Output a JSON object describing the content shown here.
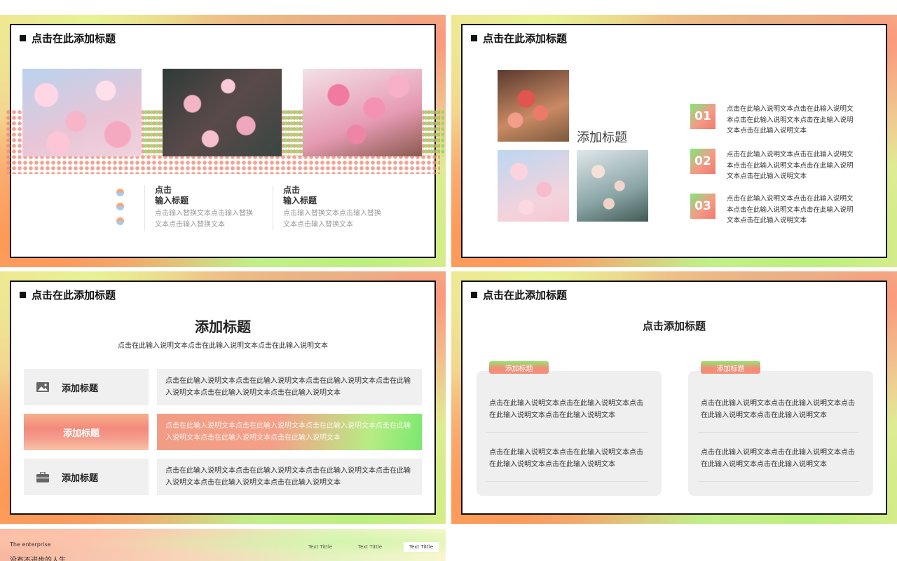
{
  "slide1": {
    "title": "点击在此添加标题",
    "items": [
      {
        "head1": "点击",
        "head2": "输入标题",
        "body": "点击输入替换文本点击输入替换文本点击输入替换文本"
      },
      {
        "head1": "点击",
        "head2": "输入标题",
        "body": "点击输入替换文本点击输入替换文本点击输入替换文本"
      }
    ]
  },
  "slide2": {
    "title": "点击在此添加标题",
    "center_title": "添加标题",
    "items": [
      {
        "num": "01",
        "text": "点击在此输入说明文本点击在此输入说明文本点击在此输入说明文本点击在此输入说明文本点击在此输入说明文本"
      },
      {
        "num": "02",
        "text": "点击在此输入说明文本点击在此输入说明文本点击在此输入说明文本点击在此输入说明文本点击在此输入说明文本"
      },
      {
        "num": "03",
        "text": "点击在此输入说明文本点击在此输入说明文本点击在此输入说明文本点击在此输入说明文本点击在此输入说明文本"
      }
    ]
  },
  "slide3": {
    "title": "点击在此添加标题",
    "heading": "添加标题",
    "subheading": "点击在此输入说明文本点击在此输入说明文本点击在此输入说明文本",
    "rows": [
      {
        "label": "添加标题",
        "icon": "image-icon",
        "text": "点击在此输入说明文本点击在此输入说明文本点击在此输入说明文本点击在此输入说明文本点击在此输入说明文本点击在此输入说明文本"
      },
      {
        "label": "添加标题",
        "icon": "",
        "text": "点击在此输入说明文本点击在此输入说明文本点击在此输入说明文本点击在此输入说明文本点击在此输入说明文本点击在此输入说明文本"
      },
      {
        "label": "添加标题",
        "icon": "briefcase-icon",
        "text": "点击在此输入说明文本点击在此输入说明文本点击在此输入说明文本点击在此输入说明文本点击在此输入说明文本点击在此输入说明文本"
      }
    ]
  },
  "slide4": {
    "title": "点击在此添加标题",
    "heading": "点击添加标题",
    "cards": [
      {
        "tag": "添加标题",
        "entries": [
          "点击在此输入说明文本点击在此输入说明文本点击在此输入说明文本点击在此输入说明文本",
          "点击在此输入说明文本点击在此输入说明文本点击在此输入说明文本点击在此输入说明文本"
        ]
      },
      {
        "tag": "添加标题",
        "entries": [
          "点击在此输入说明文本点击在此输入说明文本点击在此输入说明文本点击在此输入说明文本",
          "点击在此输入说明文本点击在此输入说明文本点击在此输入说明文本点击在此输入说明文本"
        ]
      }
    ]
  },
  "slide5": {
    "company": "The enterprise",
    "tagline": "没有不进步的人生,",
    "tabs": [
      "Text Tittle",
      "Text Tittle",
      "Text Tittle"
    ]
  }
}
